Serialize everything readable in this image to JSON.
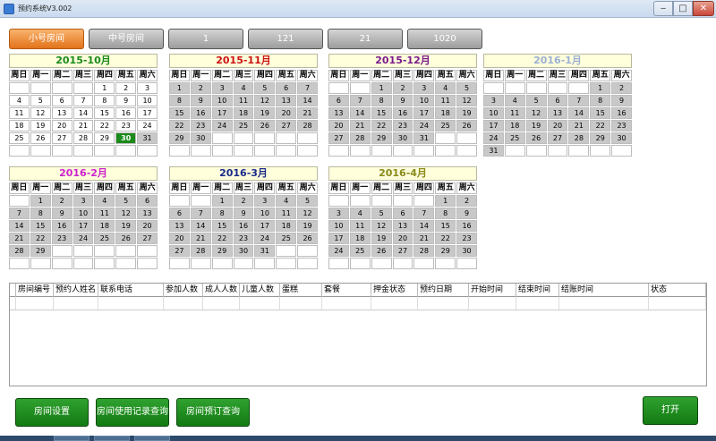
{
  "window": {
    "title": "预约系统V3.002",
    "min_glyph": "‒",
    "max_glyph": "□",
    "close_glyph": "✕"
  },
  "tabs": [
    {
      "label": "小号房间",
      "active": true
    },
    {
      "label": "中号房间",
      "active": false
    },
    {
      "label": "1",
      "active": false
    },
    {
      "label": "121",
      "active": false
    },
    {
      "label": "21",
      "active": false
    },
    {
      "label": "1020",
      "active": false
    }
  ],
  "weekdays": [
    "周日",
    "周一",
    "周二",
    "周三",
    "周四",
    "周五",
    "周六"
  ],
  "calendars": [
    {
      "title": "2015-10月",
      "color": "#1a8a1a",
      "offset": 4,
      "days": 31,
      "style": "white",
      "highlight": 30,
      "grayFrom": 31
    },
    {
      "title": "2015-11月",
      "color": "#cc1111",
      "offset": 0,
      "days": 30,
      "style": "gray"
    },
    {
      "title": "2015-12月",
      "color": "#7a1a8a",
      "offset": 2,
      "days": 31,
      "style": "gray"
    },
    {
      "title": "2016-1月",
      "color": "#9bb0d4",
      "offset": 5,
      "days": 31,
      "style": "gray"
    },
    {
      "title": "2016-2月",
      "color": "#cc22cc",
      "offset": 1,
      "days": 29,
      "style": "gray"
    },
    {
      "title": "2016-3月",
      "color": "#1a2a8a",
      "offset": 2,
      "days": 31,
      "style": "gray"
    },
    {
      "title": "2016-4月",
      "color": "#8a8a1a",
      "offset": 5,
      "days": 30,
      "style": "gray"
    }
  ],
  "table": {
    "columns": [
      "房间编号",
      "预约人姓名",
      "联系电话",
      "参加人数",
      "成人人数",
      "儿童人数",
      "蛋糕",
      "套餐",
      "押金状态",
      "预约日期",
      "开始时间",
      "结束时间",
      "结账时间",
      "状态"
    ]
  },
  "buttons": {
    "room_settings": "房间设置",
    "room_usage_query": "房间使用记录查询",
    "room_booking_query": "房间预订查询",
    "open": "打开"
  }
}
